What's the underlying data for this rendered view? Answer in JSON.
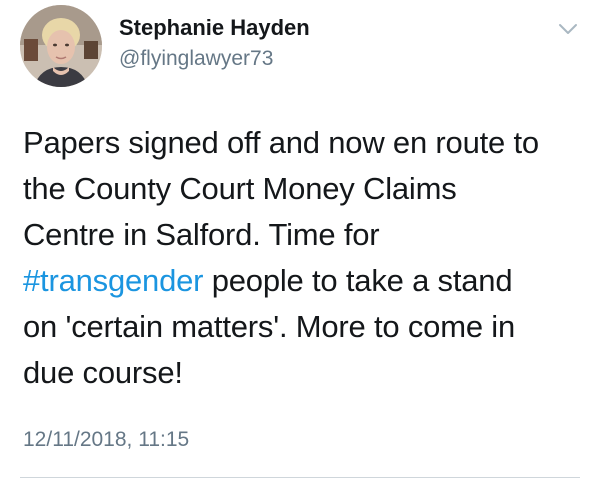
{
  "author": {
    "display_name": "Stephanie Hayden",
    "handle": "@flyinglawyer73",
    "avatar_icon": "profile-photo"
  },
  "menu": {
    "icon": "chevron-down-icon"
  },
  "tweet": {
    "lines": [
      {
        "text": "Papers signed off and now en route to"
      },
      {
        "text": "the County Court Money Claims"
      },
      {
        "text": "Centre in Salford. Time for"
      },
      {
        "hashtag": "#transgender",
        "text": " people to take a stand"
      },
      {
        "text": "on 'certain matters'. More to come in"
      },
      {
        "text": "due course!"
      }
    ],
    "timestamp": "12/11/2018, 11:15"
  },
  "colors": {
    "hashtag": "#1b95e0",
    "secondary_text": "#657786",
    "primary_text": "#14171a"
  }
}
